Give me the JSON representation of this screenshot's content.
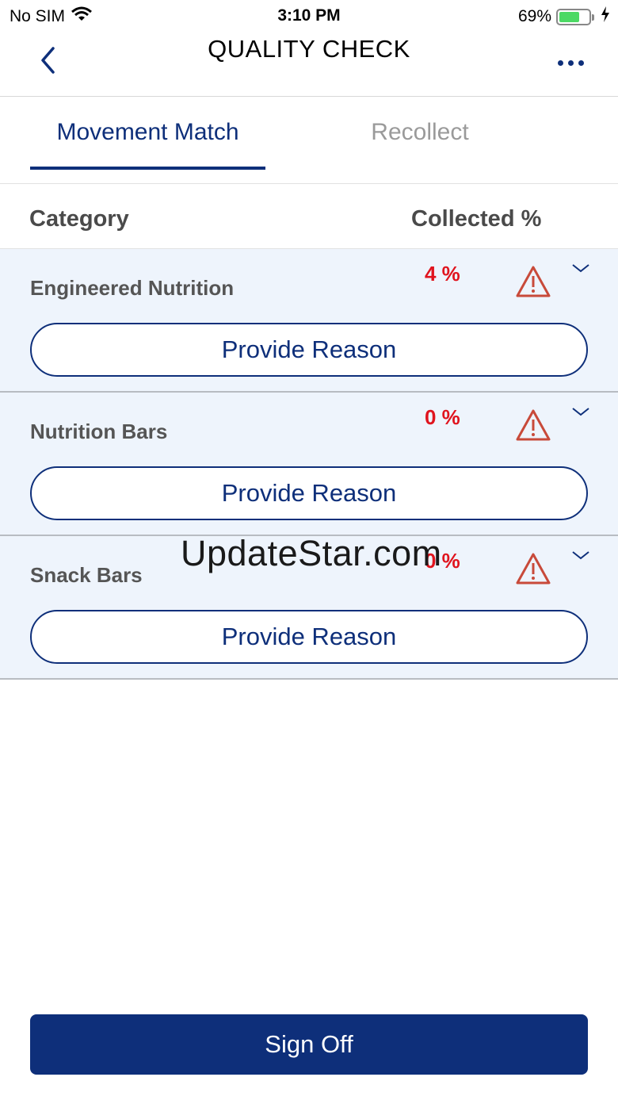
{
  "status_bar": {
    "carrier": "No SIM",
    "time": "3:10 PM",
    "battery": "69%",
    "battery_level": 0.69
  },
  "nav": {
    "title": "QUALITY CHECK",
    "back_icon": "chevron-left-icon",
    "more_icon": "more-horizontal-icon"
  },
  "tabs": [
    {
      "label": "Movement Match",
      "active": true
    },
    {
      "label": "Recollect",
      "active": false
    }
  ],
  "table": {
    "headers": {
      "category": "Category",
      "collected": "Collected %"
    },
    "rows": [
      {
        "name": "Engineered Nutrition",
        "collected": "4 %",
        "button": "Provide Reason"
      },
      {
        "name": "Nutrition Bars",
        "collected": "0 %",
        "button": "Provide Reason"
      },
      {
        "name": "Snack Bars",
        "collected": "0 %",
        "button": "Provide Reason"
      }
    ]
  },
  "watermark": "UpdateStar.com",
  "footer": {
    "sign_off_label": "Sign Off"
  },
  "colors": {
    "primary": "#0e2f7a",
    "row_bg": "#eef4fc",
    "alert": "#e0141e",
    "warning_icon": "#c84a3a",
    "inactive_tab": "#9a9a9a"
  }
}
